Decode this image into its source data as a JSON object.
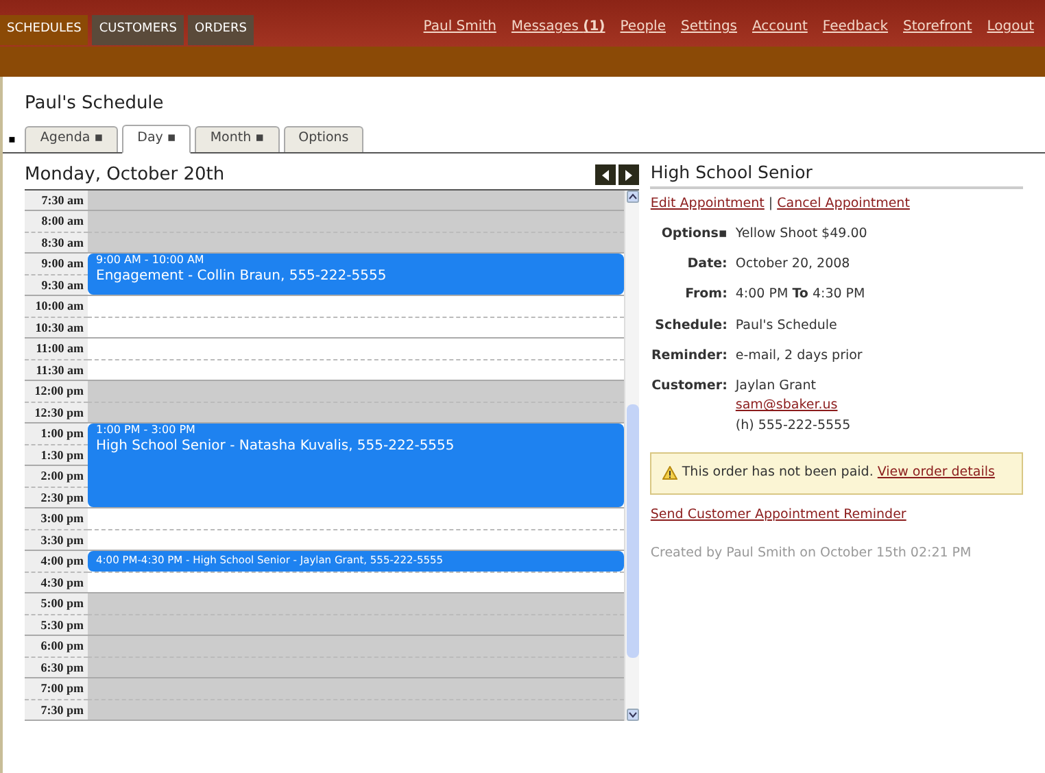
{
  "nav": {
    "tabs": [
      {
        "label": "SCHEDULES",
        "selected": true
      },
      {
        "label": "CUSTOMERS",
        "selected": false
      },
      {
        "label": "ORDERS",
        "selected": false
      }
    ],
    "links": [
      "Paul Smith",
      "Messages **(1)**",
      "People",
      "Settings",
      "Account",
      "Feedback",
      "Storefront",
      "Logout"
    ]
  },
  "page_title": "Paul's Schedule",
  "tab_marker": "▪",
  "tabs": [
    {
      "label": "Agenda ▪",
      "selected": false
    },
    {
      "label": "Day ▪",
      "selected": true
    },
    {
      "label": "Month ▪",
      "selected": false
    },
    {
      "label": "Options",
      "selected": false
    }
  ],
  "day_title": "Monday, October 20th",
  "slots": [
    {
      "label": "7:30 am",
      "kind": "open",
      "shaded": true
    },
    {
      "label": "8:00 am",
      "kind": "open",
      "shaded": true
    },
    {
      "label": "8:30 am",
      "kind": "open",
      "shaded": true
    },
    {
      "label": "9:00 am",
      "kind": "appointment",
      "event": {
        "kind": "full",
        "time": "9:00 AM - 10:00 AM",
        "title": "Engagement - Collin Braun, 555-222-5555"
      }
    },
    {
      "label": "9:30 am",
      "kind": "continued"
    },
    {
      "label": "10:00 am",
      "kind": "open",
      "shaded": false
    },
    {
      "label": "10:30 am",
      "kind": "open",
      "shaded": false
    },
    {
      "label": "11:00 am",
      "kind": "open",
      "shaded": false
    },
    {
      "label": "11:30 am",
      "kind": "open",
      "shaded": false
    },
    {
      "label": "12:00 pm",
      "kind": "open",
      "shaded": true
    },
    {
      "label": "12:30 pm",
      "kind": "open",
      "shaded": true
    },
    {
      "label": "1:00 pm",
      "kind": "appointment",
      "event": {
        "kind": "full",
        "time": "1:00 PM - 3:00 PM",
        "title": "High School Senior - Natasha Kuvalis, 555-222-5555"
      }
    },
    {
      "label": "1:30 pm",
      "kind": "continued"
    },
    {
      "label": "2:00 pm",
      "kind": "continued"
    },
    {
      "label": "2:30 pm",
      "kind": "continued"
    },
    {
      "label": "3:00 pm",
      "kind": "open",
      "shaded": false
    },
    {
      "label": "3:30 pm",
      "kind": "open",
      "shaded": false
    },
    {
      "label": "4:00 pm",
      "kind": "appointment",
      "event": {
        "kind": "compact",
        "title": "4:00 PM-4:30 PM - High School Senior - Jaylan Grant, 555-222-5555"
      }
    },
    {
      "label": "4:30 pm",
      "kind": "open",
      "shaded": false
    },
    {
      "label": "5:00 pm",
      "kind": "open",
      "shaded": true
    },
    {
      "label": "5:30 pm",
      "kind": "open",
      "shaded": true
    },
    {
      "label": "6:00 pm",
      "kind": "open",
      "shaded": true
    },
    {
      "label": "6:30 pm",
      "kind": "open",
      "shaded": true
    },
    {
      "label": "7:00 pm",
      "kind": "open",
      "shaded": true
    },
    {
      "label": "7:30 pm",
      "kind": "open",
      "shaded": true
    }
  ],
  "detail": {
    "title": "High School Senior",
    "actions": [
      "Edit Appointment",
      "Cancel Appointment"
    ],
    "action_separator": "|",
    "fields": [
      {
        "label": "Options▪",
        "lines": [
          {
            "kind": "text",
            "text": "Yellow Shoot $49.00"
          }
        ]
      },
      {
        "label": "Date:",
        "lines": [
          {
            "kind": "text",
            "text": "October 20, 2008"
          }
        ]
      },
      {
        "label": "From:",
        "lines": [
          {
            "kind": "text",
            "text": "4:00 PM **To** 4:30 PM"
          }
        ]
      },
      {
        "label": "Schedule:",
        "lines": [
          {
            "kind": "text",
            "text": "Paul's Schedule"
          }
        ]
      },
      {
        "label": "Reminder:",
        "lines": [
          {
            "kind": "text",
            "text": "e-mail, 2 days prior"
          }
        ]
      },
      {
        "label": "Customer:",
        "lines": [
          {
            "kind": "text",
            "text": "Jaylan Grant"
          },
          {
            "kind": "link",
            "text": "sam@sbaker.us"
          },
          {
            "kind": "text",
            "text": "(h) 555-222-5555"
          }
        ]
      }
    ],
    "notice": {
      "text": "This order has not been paid.",
      "link": "View order details"
    },
    "reminder_link": "Send Customer Appointment Reminder",
    "created": "Created by Paul Smith on October 15th 02:21 PM"
  }
}
